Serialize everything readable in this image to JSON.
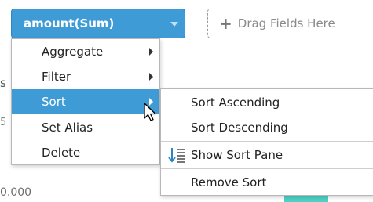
{
  "field": {
    "label": "amount(Sum)"
  },
  "drop_zone": {
    "label": "Drag Fields Here"
  },
  "context_menu": {
    "items": [
      {
        "label": "Aggregate"
      },
      {
        "label": "Filter"
      },
      {
        "label": "Sort"
      },
      {
        "label": "Set Alias"
      },
      {
        "label": "Delete"
      }
    ]
  },
  "sort_submenu": {
    "items": [
      {
        "label": "Sort Ascending"
      },
      {
        "label": "Sort Descending"
      },
      {
        "label": "Show Sort Pane",
        "icon": "sort-pane-icon"
      },
      {
        "label": "Remove Sort"
      }
    ]
  },
  "background": {
    "axis_value": "0.000",
    "fragment_1": "s",
    "fragment_2": "5"
  },
  "colors": {
    "accent": "#3e9bd6",
    "bar": "#4fd1c5"
  }
}
